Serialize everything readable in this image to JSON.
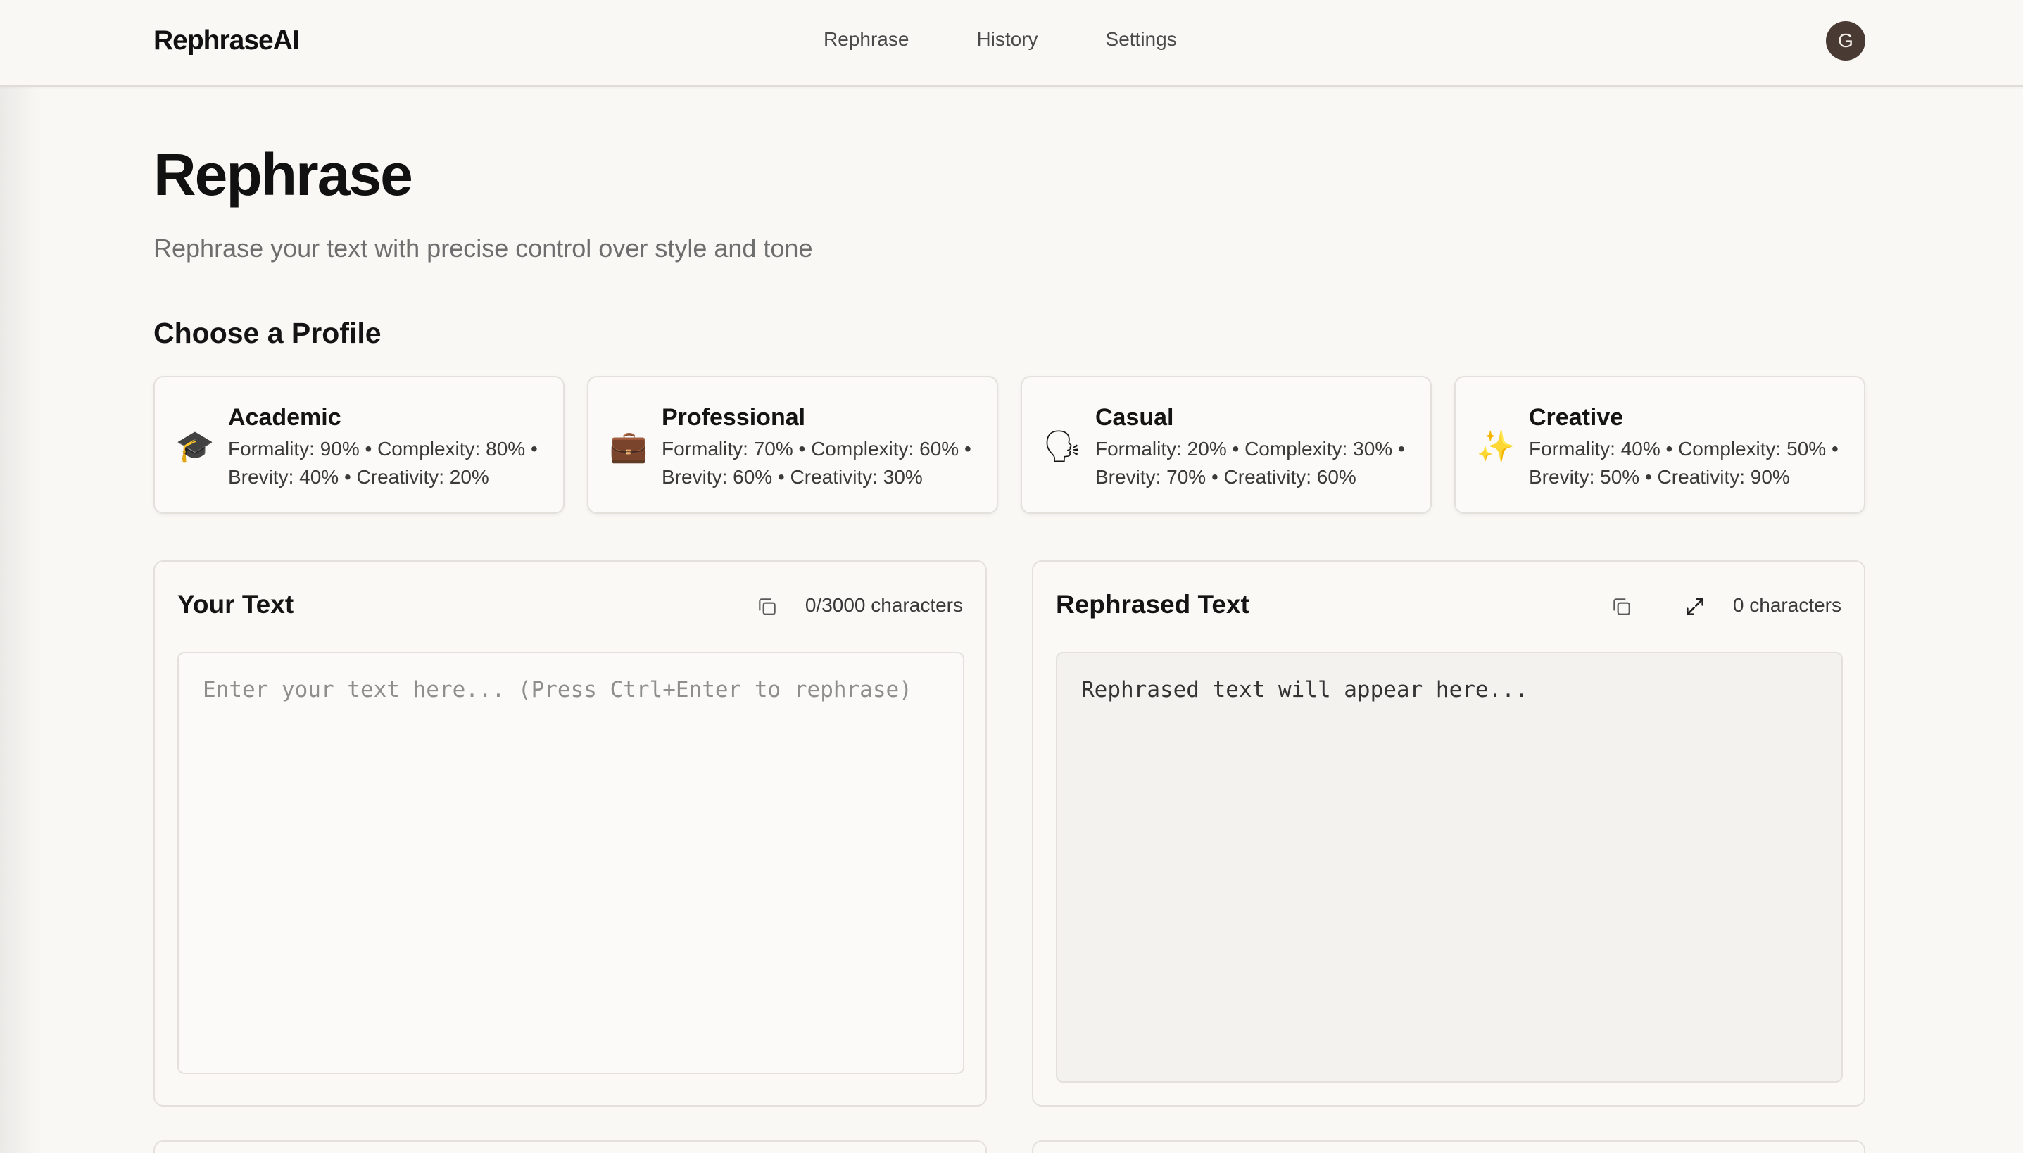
{
  "app": {
    "logo": "RephraseAI",
    "avatar_initial": "G"
  },
  "nav": {
    "items": [
      {
        "label": "Rephrase"
      },
      {
        "label": "History"
      },
      {
        "label": "Settings"
      }
    ]
  },
  "page": {
    "title": "Rephrase",
    "subtitle": "Rephrase your text with precise control over style and tone",
    "profiles_heading": "Choose a Profile"
  },
  "profiles": [
    {
      "name": "Academic",
      "emoji": "🎓",
      "icon": "graduation-cap-icon",
      "stats": "Formality: 90% • Complexity: 80% • Brevity: 40% • Creativity: 20%"
    },
    {
      "name": "Professional",
      "emoji": "💼",
      "icon": "briefcase-icon",
      "stats": "Formality: 70% • Complexity: 60% • Brevity: 60% • Creativity: 30%"
    },
    {
      "name": "Casual",
      "emoji": "🗣",
      "icon": "speaking-head-icon",
      "stats": "Formality: 20% • Complexity: 30% • Brevity: 70% • Creativity: 60%"
    },
    {
      "name": "Creative",
      "emoji": "✨",
      "icon": "sparkles-icon",
      "stats": "Formality: 40% • Complexity: 50% • Brevity: 50% • Creativity: 90%"
    }
  ],
  "input": {
    "title": "Your Text",
    "count": "0/3000 characters",
    "placeholder": "Enter your text here... (Press Ctrl+Enter to rephrase)",
    "value": ""
  },
  "output": {
    "title": "Rephrased Text",
    "count": "0 characters",
    "placeholder_text": "Rephrased text will appear here..."
  },
  "colors": {
    "background": "#f9f8f5",
    "avatar": "#4a3a34",
    "border": "#e4e1dc"
  }
}
